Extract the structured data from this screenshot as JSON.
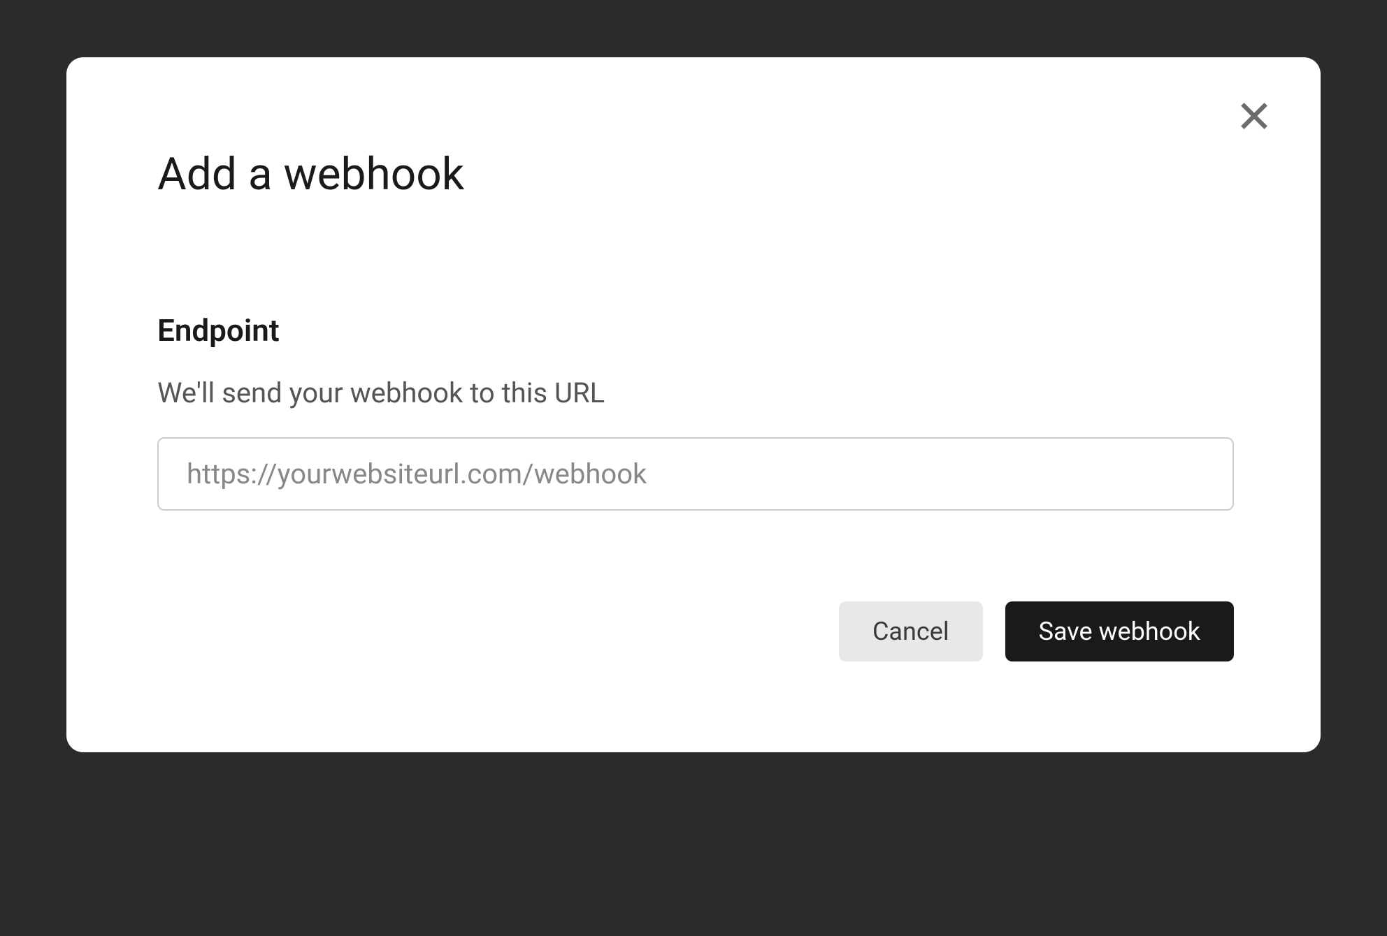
{
  "modal": {
    "title": "Add a webhook",
    "endpoint": {
      "label": "Endpoint",
      "description": "We'll send your webhook to this URL",
      "placeholder": "https://yourwebsiteurl.com/webhook",
      "value": ""
    },
    "buttons": {
      "cancel": "Cancel",
      "save": "Save webhook"
    }
  }
}
